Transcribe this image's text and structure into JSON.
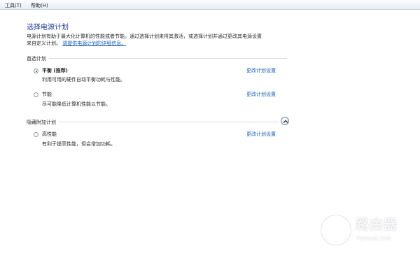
{
  "menu": {
    "tools": "工具(T)",
    "help": "帮助(H)"
  },
  "page_title": "选择电源计划",
  "description": {
    "line1": "电源计划有助于最大化计算机的性能或者节能。通过选择计划来将其激活，或选择计划并通过更改其电源设置",
    "line2_prefix": "来自定义计划。",
    "link": "请提供电源计划的详细信息。"
  },
  "preferred_section": "首选计划",
  "hidden_section": "隐藏附加计划",
  "plans": [
    {
      "name": "平衡 (推荐)",
      "desc": "利用可用的硬件自动平衡功耗与性能。",
      "link": "更改计划设置",
      "selected": true
    },
    {
      "name": "节能",
      "desc": "尽可能降低计算机性能以节能。",
      "link": "更改计划设置",
      "selected": false
    },
    {
      "name": "高性能",
      "desc": "有利于提高性能，但会增加功耗。",
      "link": "更改计划设置",
      "selected": false
    }
  ],
  "watermark": {
    "title": "路由器",
    "url": "luyouqi.com"
  },
  "icons": {
    "collapse": "chevron-up-icon",
    "watermark": "router-logo-icon"
  },
  "colors": {
    "title": "#1f3b8a",
    "link": "#1a5fb4"
  }
}
